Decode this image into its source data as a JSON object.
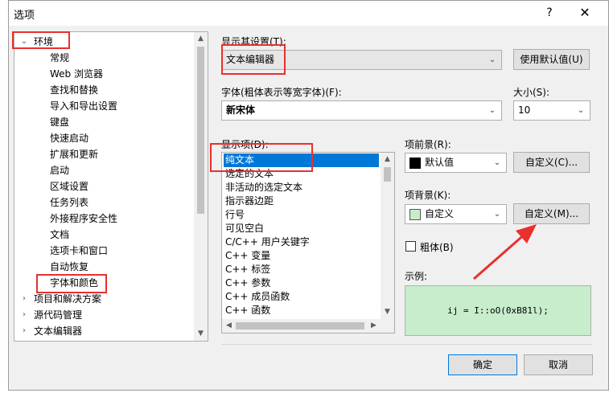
{
  "dialog": {
    "title": "选项",
    "help_label": "?",
    "close_label": "✕"
  },
  "tree": {
    "items": [
      {
        "label": "环境",
        "arrow": "⌄"
      },
      {
        "label": "常规"
      },
      {
        "label": "Web 浏览器"
      },
      {
        "label": "查找和替换"
      },
      {
        "label": "导入和导出设置"
      },
      {
        "label": "键盘"
      },
      {
        "label": "快速启动"
      },
      {
        "label": "扩展和更新"
      },
      {
        "label": "启动"
      },
      {
        "label": "区域设置"
      },
      {
        "label": "任务列表"
      },
      {
        "label": "外接程序安全性"
      },
      {
        "label": "文档"
      },
      {
        "label": "选项卡和窗口"
      },
      {
        "label": "自动恢复"
      },
      {
        "label": "字体和颜色"
      },
      {
        "label": "项目和解决方案",
        "arrow": "›"
      },
      {
        "label": "源代码管理",
        "arrow": "›"
      },
      {
        "label": "文本编辑器",
        "arrow": "›"
      }
    ],
    "scroll_up": "▲",
    "scroll_down": "▼"
  },
  "display_settings": {
    "label": "显示其设置(T):",
    "value": "文本编辑器",
    "caret": "⌄",
    "use_defaults_label": "使用默认值(U)"
  },
  "font": {
    "label": "字体(粗体表示等宽字体)(F):",
    "value": "新宋体",
    "caret": "⌄"
  },
  "size": {
    "label": "大小(S):",
    "value": "10",
    "caret": "⌄"
  },
  "display_items": {
    "label": "显示项(D):",
    "items": [
      "纯文本",
      "选定的文本",
      "非活动的选定文本",
      "指示器边距",
      "行号",
      "可见空白",
      "C/C++ 用户关键字",
      "C++ 变量",
      "C++ 标签",
      "C++ 参数",
      "C++ 成员函数",
      "C++ 函数"
    ],
    "selected_index": 0,
    "scroll_up": "▲",
    "scroll_down": "▼",
    "scroll_left": "◀",
    "scroll_right": "▶"
  },
  "foreground": {
    "label": "项前景(R):",
    "value": "默认值",
    "swatch_color": "#000000",
    "caret": "⌄",
    "custom_label": "自定义(C)..."
  },
  "background": {
    "label": "项背景(K):",
    "value": "自定义",
    "swatch_color": "#c7edcc",
    "caret": "⌄",
    "custom_label": "自定义(M)..."
  },
  "bold": {
    "label": "粗体(B)",
    "checked": false
  },
  "sample": {
    "label": "示例:",
    "text": "ij = I::oO(0xB81l);"
  },
  "footer": {
    "ok_label": "确定",
    "cancel_label": "取消"
  },
  "colors": {
    "selection": "#0078d7",
    "highlight_box": "#e8302e",
    "sample_bg": "#c7edcc"
  }
}
